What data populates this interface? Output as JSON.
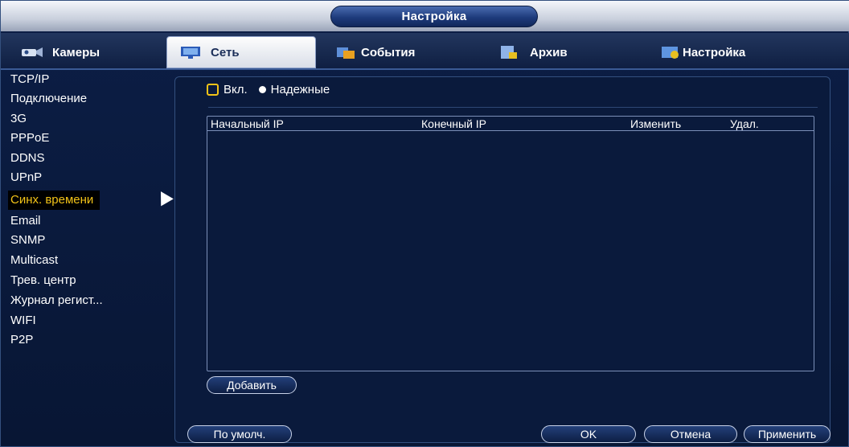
{
  "window": {
    "title": "Настройка"
  },
  "tabs": [
    {
      "label": "Камеры",
      "icon": "camera-icon",
      "active": false
    },
    {
      "label": "Сеть",
      "icon": "network-icon",
      "active": true
    },
    {
      "label": "События",
      "icon": "events-icon",
      "active": false
    },
    {
      "label": "Архив",
      "icon": "archive-icon",
      "active": false
    },
    {
      "label": "Настройка",
      "icon": "settings-icon",
      "active": false
    }
  ],
  "sidebar": {
    "items": [
      {
        "label": "TCP/IP"
      },
      {
        "label": "Подключение"
      },
      {
        "label": "3G"
      },
      {
        "label": "PPPoE"
      },
      {
        "label": "DDNS"
      },
      {
        "label": "UPnP"
      },
      {
        "label": "Синх. времени",
        "active": true
      },
      {
        "label": "Email"
      },
      {
        "label": "SNMP"
      },
      {
        "label": "Multicast"
      },
      {
        "label": "Трев. центр"
      },
      {
        "label": "Журнал регист..."
      },
      {
        "label": "WIFI"
      },
      {
        "label": "P2P"
      }
    ]
  },
  "options": {
    "enable_label": "Вкл.",
    "enable_checked": false,
    "mode_label": "Надежные"
  },
  "table": {
    "columns": [
      "Начальный IP",
      "Конечный IP",
      "Изменить",
      "Удал."
    ],
    "rows": []
  },
  "buttons": {
    "add": "Добавить",
    "default": "По умолч.",
    "ok": "OK",
    "cancel": "Отмена",
    "apply": "Применить"
  },
  "colors": {
    "background": "#0a1a3a",
    "accent": "#f2c318",
    "active_tab_bg": "#ffffff",
    "selected_item_bg": "#000000"
  }
}
